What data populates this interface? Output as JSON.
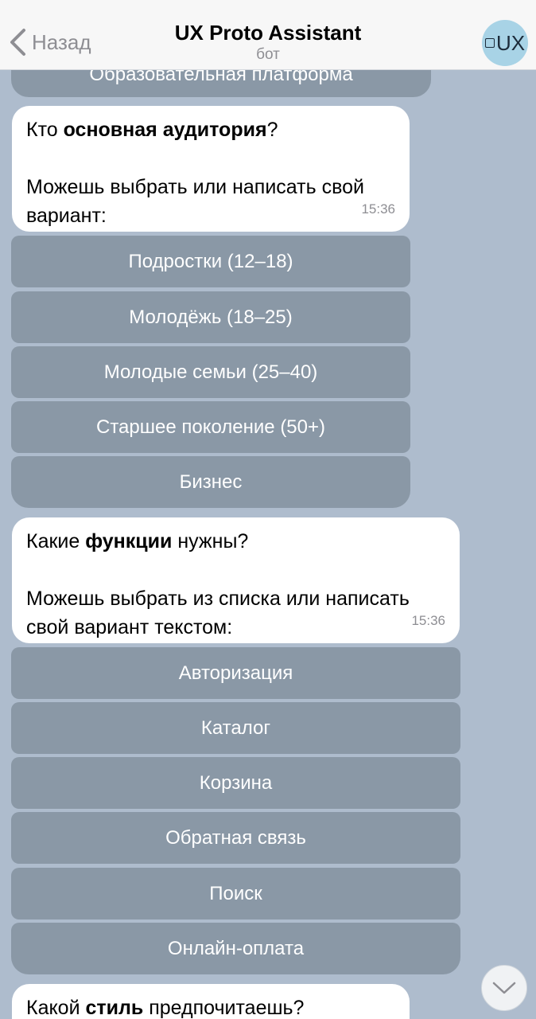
{
  "header": {
    "back_label": "Назад",
    "title": "UX Proto Assistant",
    "subtitle": "бот",
    "avatar_text": "UX"
  },
  "chat": {
    "partial_button": "Образовательная платформа",
    "audience_message": {
      "q_prefix": "Кто ",
      "q_bold": "основная аудитория",
      "q_suffix": "?",
      "body_line1": "Можешь выбрать или написать свой",
      "body_line2": "вариант:",
      "time": "15:36"
    },
    "audience_buttons": [
      "Подростки (12–18)",
      "Молодёжь (18–25)",
      "Молодые семьи (25–40)",
      "Старшее поколение (50+)",
      "Бизнес"
    ],
    "features_message": {
      "q_prefix": "Какие ",
      "q_bold": "функции",
      "q_suffix": " нужны?",
      "body_line1": "Можешь выбрать из списка или написать",
      "body_line2": "свой вариант текстом:",
      "time": "15:36"
    },
    "feature_buttons": [
      "Авторизация",
      "Каталог",
      "Корзина",
      "Обратная связь",
      "Поиск",
      "Онлайн-оплата"
    ],
    "style_message": {
      "q_prefix": "Какой ",
      "q_bold": "стиль",
      "q_suffix": " предпочитаешь?"
    }
  },
  "colors": {
    "chat_background": "#aebccd",
    "keyboard_button": "#8a98a6",
    "bubble": "#ffffff",
    "header": "#f7f7f7",
    "avatar": "#a8d3e6"
  },
  "icons": {
    "back": "chevron-left-icon",
    "scroll_down": "chevron-down-icon"
  }
}
